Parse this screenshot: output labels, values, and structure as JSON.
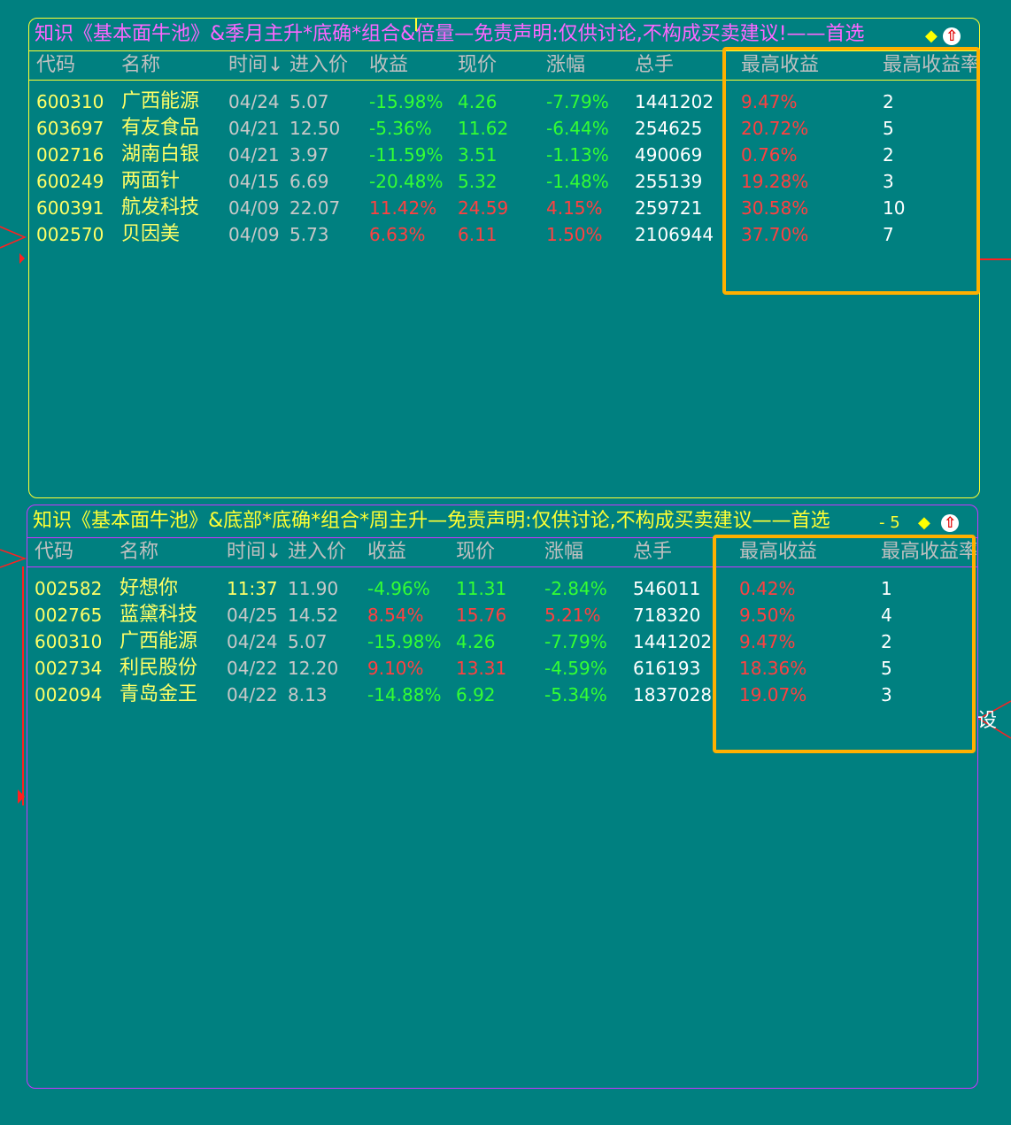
{
  "panels": [
    {
      "title": "知识《基本面牛池》&季月主升*底确*组合&倍量—免责声明:仅供讨论,不构成买卖建议!——首选",
      "count": "",
      "headers": [
        "代码",
        "名称",
        "时间↓",
        "进入价",
        "收益",
        "现价",
        "涨幅",
        "总手",
        "最高收益",
        "最高收益率"
      ],
      "rows": [
        {
          "code": "600310",
          "name": "广西能源",
          "time": "04/24",
          "entry": "5.07",
          "ret": "-15.98%",
          "price": "4.26",
          "chg": "-7.79%",
          "vol": "1441202",
          "max_ret": "9.47%",
          "max_day": "2"
        },
        {
          "code": "603697",
          "name": "有友食品",
          "time": "04/21",
          "entry": "12.50",
          "ret": "-5.36%",
          "price": "11.62",
          "chg": "-6.44%",
          "vol": "254625",
          "max_ret": "20.72%",
          "max_day": "5"
        },
        {
          "code": "002716",
          "name": "湖南白银",
          "time": "04/21",
          "entry": "3.97",
          "ret": "-11.59%",
          "price": "3.51",
          "chg": "-1.13%",
          "vol": "490069",
          "max_ret": "0.76%",
          "max_day": "2"
        },
        {
          "code": "600249",
          "name": "两面针",
          "time": "04/15",
          "entry": "6.69",
          "ret": "-20.48%",
          "price": "5.32",
          "chg": "-1.48%",
          "vol": "255139",
          "max_ret": "19.28%",
          "max_day": "3"
        },
        {
          "code": "600391",
          "name": "航发科技",
          "time": "04/09",
          "entry": "22.07",
          "ret": "11.42%",
          "price": "24.59",
          "chg": "4.15%",
          "vol": "259721",
          "max_ret": "30.58%",
          "max_day": "10"
        },
        {
          "code": "002570",
          "name": "贝因美",
          "time": "04/09",
          "entry": "5.73",
          "ret": "6.63%",
          "price": "6.11",
          "chg": "1.50%",
          "vol": "2106944",
          "max_ret": "37.70%",
          "max_day": "7"
        }
      ]
    },
    {
      "title": "知识《基本面牛池》&底部*底确*组合*周主升—免责声明:仅供讨论,不构成买卖建议——首选",
      "count": "- 5",
      "headers": [
        "代码",
        "名称",
        "时间↓",
        "进入价",
        "收益",
        "现价",
        "涨幅",
        "总手",
        "最高收益",
        "最高收益率"
      ],
      "rows": [
        {
          "code": "002582",
          "name": "好想你",
          "time": "11:37",
          "entry": "11.90",
          "ret": "-4.96%",
          "price": "11.31",
          "chg": "-2.84%",
          "vol": "546011",
          "max_ret": "0.42%",
          "max_day": "1"
        },
        {
          "code": "002765",
          "name": "蓝黛科技",
          "time": "04/25",
          "entry": "14.52",
          "ret": "8.54%",
          "price": "15.76",
          "chg": "5.21%",
          "vol": "718320",
          "max_ret": "9.50%",
          "max_day": "4"
        },
        {
          "code": "600310",
          "name": "广西能源",
          "time": "04/24",
          "entry": "5.07",
          "ret": "-15.98%",
          "price": "4.26",
          "chg": "-7.79%",
          "vol": "1441202",
          "max_ret": "9.47%",
          "max_day": "2"
        },
        {
          "code": "002734",
          "name": "利民股份",
          "time": "04/22",
          "entry": "12.20",
          "ret": "9.10%",
          "price": "13.31",
          "chg": "-4.59%",
          "vol": "616193",
          "max_ret": "18.36%",
          "max_day": "5"
        },
        {
          "code": "002094",
          "name": "青岛金王",
          "time": "04/22",
          "entry": "8.13",
          "ret": "-14.88%",
          "price": "6.92",
          "chg": "-5.34%",
          "vol": "1837028",
          "max_ret": "19.07%",
          "max_day": "3"
        }
      ]
    }
  ],
  "edge_label": "设",
  "colors": {
    "background": "#008080",
    "panel1_border": "#ffff33",
    "panel2_border": "#cc33ff",
    "highlight": "#ffb000",
    "up": "#ff4040",
    "down": "#33ff33"
  }
}
